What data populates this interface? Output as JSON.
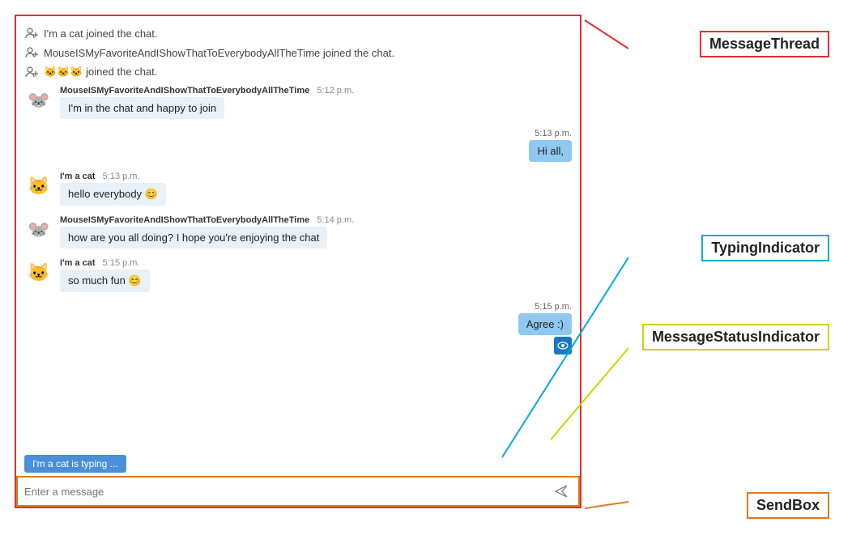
{
  "labels": {
    "messageThread": "MessageThread",
    "typingIndicator": "TypingIndicator",
    "messageStatusIndicator": "MessageStatusIndicator",
    "sendBox": "SendBox"
  },
  "joinEvents": [
    {
      "id": "join1",
      "text": "I'm a cat joined the chat."
    },
    {
      "id": "join2",
      "text": "MouseISMyFavoriteAndIShowThatToEverybodyAllTheTime joined the chat."
    },
    {
      "id": "join3",
      "text": "🐱🐱🐱 joined the chat."
    }
  ],
  "messages": [
    {
      "id": "msg1",
      "type": "incoming",
      "avatar": "🐭",
      "sender": "MouseISMyFavoriteAndIShowThatToEverybodyAllTheTime",
      "time": "5:12 p.m.",
      "text": "I'm in the chat and happy to join"
    },
    {
      "id": "msg2",
      "type": "outgoing",
      "time": "5:13 p.m.",
      "text": "Hi all,"
    },
    {
      "id": "msg3",
      "type": "incoming",
      "avatar": "🐱",
      "sender": "I'm a cat",
      "time": "5:13 p.m.",
      "text": "hello everybody 😊"
    },
    {
      "id": "msg4",
      "type": "incoming",
      "avatar": "🐭",
      "sender": "MouseISMyFavoriteAndIShowThatToEverybodyAllTheTime",
      "time": "5:14 p.m.",
      "text": "how are you all doing? I hope you're enjoying the chat"
    },
    {
      "id": "msg5",
      "type": "incoming",
      "avatar": "🐱",
      "sender": "I'm a cat",
      "time": "5:15 p.m.",
      "text": "so much fun 😊"
    },
    {
      "id": "msg6",
      "type": "outgoing",
      "time": "5:15 p.m.",
      "text": "Agree :)",
      "hasStatus": true
    }
  ],
  "typingIndicator": {
    "text": "I'm a cat is typing ..."
  },
  "sendBox": {
    "placeholder": "Enter a message"
  }
}
